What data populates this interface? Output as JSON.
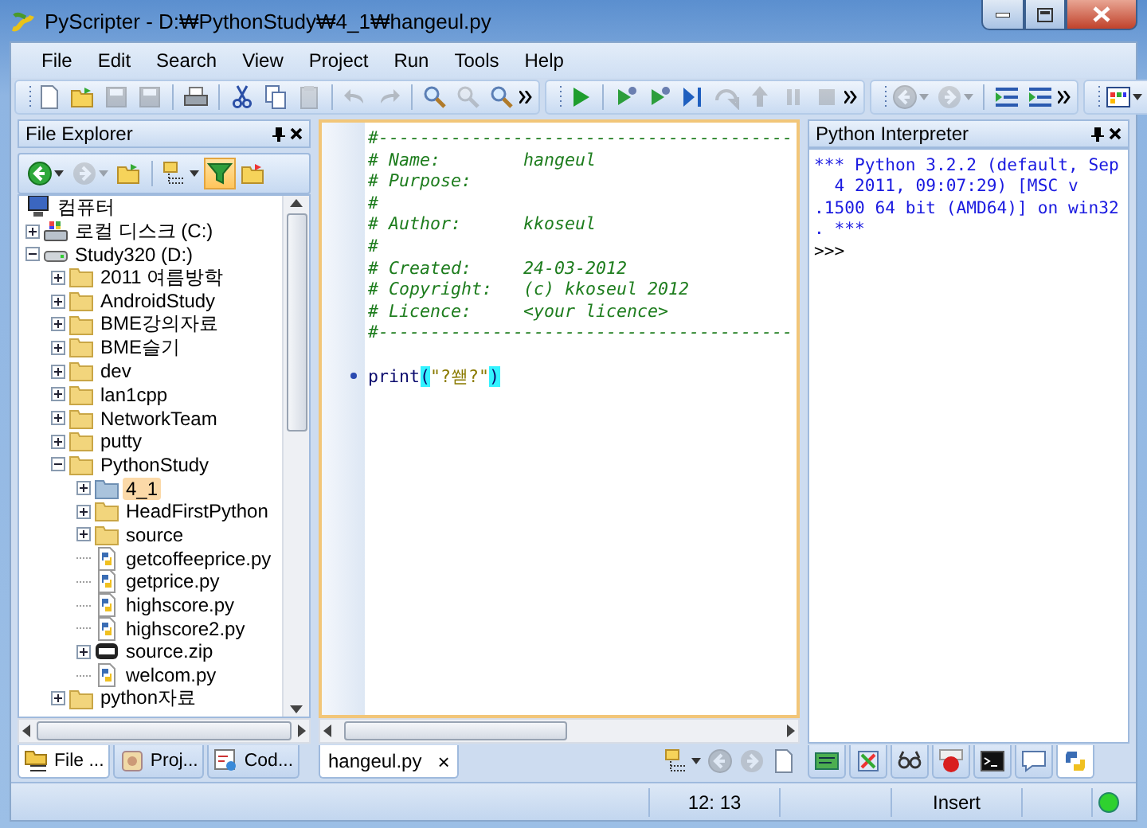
{
  "window": {
    "title": "PyScripter - D:₩PythonStudy₩4_1₩hangeul.py"
  },
  "menu": [
    "File",
    "Edit",
    "Search",
    "View",
    "Project",
    "Run",
    "Tools",
    "Help"
  ],
  "toolbars": [
    {
      "groups": [
        [
          {
            "kind": "new",
            "disabled": false
          },
          {
            "kind": "open",
            "disabled": false
          },
          {
            "kind": "save",
            "disabled": true
          },
          {
            "kind": "save-all",
            "disabled": true
          }
        ],
        [
          {
            "kind": "print",
            "disabled": false
          }
        ],
        [
          {
            "kind": "cut",
            "disabled": false
          },
          {
            "kind": "copy",
            "disabled": false
          },
          {
            "kind": "paste",
            "disabled": true
          }
        ],
        [
          {
            "kind": "undo",
            "disabled": true
          },
          {
            "kind": "redo",
            "disabled": true
          }
        ],
        [
          {
            "kind": "find",
            "disabled": false
          },
          {
            "kind": "find-next",
            "disabled": true
          },
          {
            "kind": "find-files",
            "disabled": false
          }
        ]
      ]
    },
    {
      "groups": [
        [
          {
            "kind": "run",
            "disabled": false
          }
        ],
        [
          {
            "kind": "debug",
            "disabled": false
          },
          {
            "kind": "run-to-cursor",
            "disabled": false
          },
          {
            "kind": "step-into",
            "disabled": false
          },
          {
            "kind": "step-over",
            "disabled": true
          },
          {
            "kind": "step-out",
            "disabled": true
          },
          {
            "kind": "pause",
            "disabled": true
          },
          {
            "kind": "stop",
            "disabled": true
          }
        ]
      ]
    },
    {
      "groups": [
        [
          {
            "kind": "back",
            "disabled": true
          },
          {
            "kind": "forward",
            "disabled": true
          }
        ],
        [
          {
            "kind": "indent",
            "disabled": false
          },
          {
            "kind": "dedent",
            "disabled": false
          }
        ]
      ]
    },
    {
      "groups": [
        [
          {
            "kind": "layout",
            "disabled": false
          }
        ]
      ]
    }
  ],
  "file_explorer": {
    "title": "File Explorer",
    "toolbar": [
      {
        "kind": "back",
        "disabled": false,
        "on": false
      },
      {
        "kind": "forward",
        "disabled": true,
        "on": false
      },
      {
        "kind": "folder-up",
        "disabled": false,
        "on": false
      },
      {
        "kind": "view",
        "disabled": false,
        "on": false
      },
      {
        "kind": "filter",
        "disabled": false,
        "on": true
      },
      {
        "kind": "favorites",
        "disabled": false,
        "on": false
      }
    ],
    "tree": {
      "name": "컴퓨터",
      "kind": "computer",
      "selected": false,
      "children": [
        {
          "name": "로컬 디스크 (C:)",
          "kind": "system-drive",
          "expanded": false,
          "selected": false
        },
        {
          "name": "Study320 (D:)",
          "kind": "drive",
          "expanded": true,
          "selected": false,
          "children": [
            {
              "name": "2011 여름방학",
              "kind": "folder",
              "expanded": false,
              "selected": false
            },
            {
              "name": "AndroidStudy",
              "kind": "folder",
              "expanded": false,
              "selected": false
            },
            {
              "name": "BME강의자료",
              "kind": "folder",
              "expanded": false,
              "selected": false
            },
            {
              "name": "BME슬기",
              "kind": "folder",
              "expanded": false,
              "selected": false
            },
            {
              "name": "dev",
              "kind": "folder",
              "expanded": false,
              "selected": false
            },
            {
              "name": "lan1cpp",
              "kind": "folder",
              "expanded": false,
              "selected": false
            },
            {
              "name": "NetworkTeam",
              "kind": "folder",
              "expanded": false,
              "selected": false
            },
            {
              "name": "putty",
              "kind": "folder",
              "expanded": false,
              "selected": false
            },
            {
              "name": "PythonStudy",
              "kind": "folder",
              "expanded": true,
              "selected": false,
              "children": [
                {
                  "name": "4_1",
                  "kind": "folder-blue",
                  "expanded": false,
                  "selected": true
                },
                {
                  "name": "HeadFirstPython",
                  "kind": "folder",
                  "expanded": false,
                  "selected": false
                },
                {
                  "name": "source",
                  "kind": "folder",
                  "expanded": false,
                  "selected": false
                },
                {
                  "name": "getcoffeeprice.py",
                  "kind": "python",
                  "selected": false
                },
                {
                  "name": "getprice.py",
                  "kind": "python",
                  "selected": false
                },
                {
                  "name": "highscore.py",
                  "kind": "python",
                  "selected": false
                },
                {
                  "name": "highscore2.py",
                  "kind": "python",
                  "selected": false
                },
                {
                  "name": "source.zip",
                  "kind": "zip",
                  "expanded": false,
                  "selected": false
                },
                {
                  "name": "welcom.py",
                  "kind": "python",
                  "selected": false
                }
              ]
            },
            {
              "name": "python자료",
              "kind": "folder",
              "expanded": false,
              "selected": false
            }
          ]
        }
      ]
    },
    "tabs": [
      {
        "label": "File ...",
        "kind": "explorer",
        "selected": true
      },
      {
        "label": "Proj...",
        "kind": "project",
        "selected": false
      },
      {
        "label": "Cod...",
        "kind": "code",
        "selected": false
      }
    ]
  },
  "editor": {
    "lines": [
      {
        "kind": "comment",
        "text": "#----------------------------------------"
      },
      {
        "kind": "comment",
        "text": "# Name:        hangeul"
      },
      {
        "kind": "comment",
        "text": "# Purpose:"
      },
      {
        "kind": "comment",
        "text": "#"
      },
      {
        "kind": "comment",
        "text": "# Author:      kkoseul"
      },
      {
        "kind": "comment",
        "text": "#"
      },
      {
        "kind": "comment",
        "text": "# Created:     24-03-2012"
      },
      {
        "kind": "comment",
        "text": "# Copyright:   (c) kkoseul 2012"
      },
      {
        "kind": "comment",
        "text": "# Licence:     <your licence>"
      },
      {
        "kind": "comment",
        "text": "#----------------------------------------"
      },
      {
        "kind": "blank"
      },
      {
        "kind": "call",
        "func": "print",
        "open": "(",
        "arg": "\"?쐗?\"",
        "close": ")",
        "marker": true
      }
    ],
    "tabs": [
      {
        "label": "hangeul.py",
        "close": "×",
        "selected": true
      }
    ]
  },
  "interpreter": {
    "title": "Python Interpreter",
    "output": [
      "*** Python 3.2.2 (default, Sep",
      "  4 2011, 09:07:29) [MSC v",
      ".1500 64 bit (AMD64)] on win32",
      ". ***"
    ],
    "prompt": ">>>",
    "tabs": [
      {
        "kind": "variables",
        "selected": false
      },
      {
        "kind": "call-stack",
        "selected": false
      },
      {
        "kind": "watches",
        "selected": false
      },
      {
        "kind": "breakpoints",
        "selected": false
      },
      {
        "kind": "console",
        "selected": false
      },
      {
        "kind": "messages",
        "selected": false
      },
      {
        "kind": "python",
        "selected": true
      }
    ]
  },
  "status_bar": {
    "position": "12: 13",
    "mode": "Insert",
    "ready": true
  }
}
